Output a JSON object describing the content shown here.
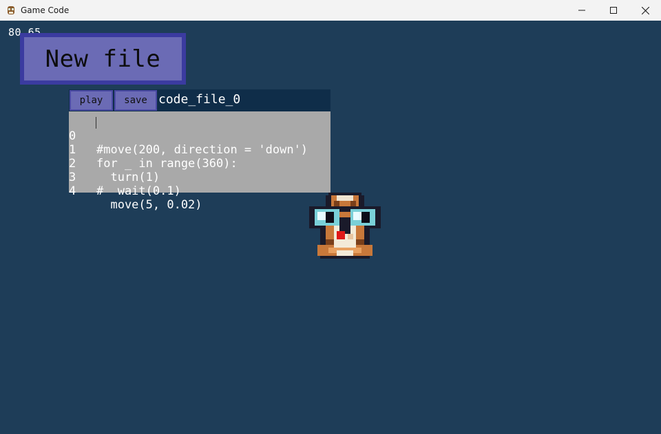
{
  "window": {
    "title": "Game Code",
    "icon": "cat-app-icon"
  },
  "hud": {
    "fps": "80.65"
  },
  "buttons": {
    "new_file": "New file",
    "play": "play",
    "save": "save"
  },
  "editor": {
    "filename": "code_file_0",
    "lines": [
      {
        "no": "0",
        "text": "#move(200, direction = 'down')"
      },
      {
        "no": "1",
        "text": "for _ in range(360):"
      },
      {
        "no": "2",
        "text": "  turn(1)"
      },
      {
        "no": "3",
        "text": "#  wait(0.1)"
      },
      {
        "no": "4",
        "text": "  move(5, 0.02)"
      }
    ]
  },
  "colors": {
    "background": "#1e3d58",
    "button_fill": "#6b6bb5",
    "button_border": "#3b3ba0",
    "toolbar": "#0f2d49",
    "code_bg": "#a9a9a9"
  },
  "sprite": {
    "name": "nerd-cat-sprite"
  }
}
